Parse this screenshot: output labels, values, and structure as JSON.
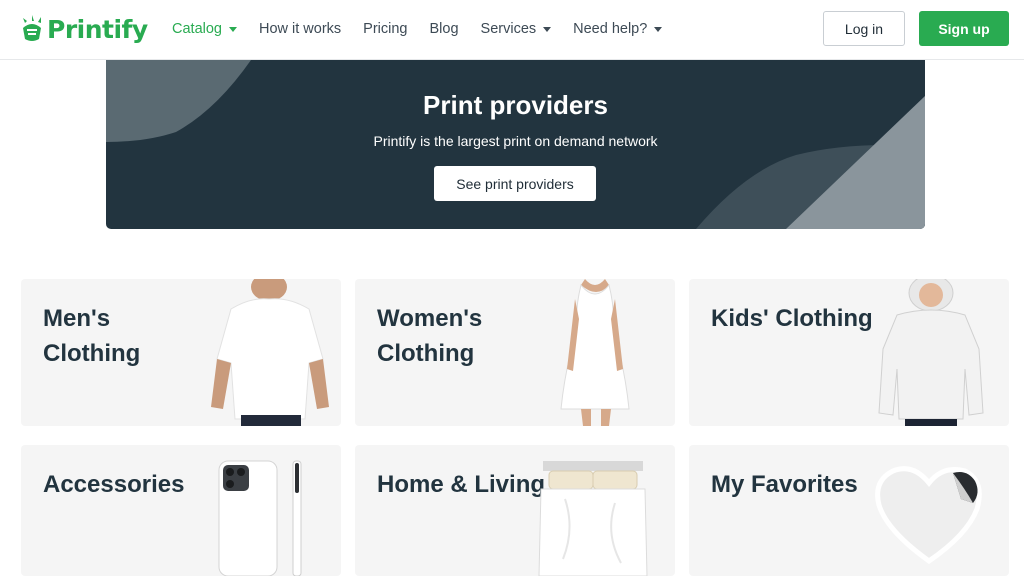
{
  "header": {
    "logo_text": "Printify",
    "nav": [
      {
        "label": "Catalog",
        "has_dropdown": true,
        "active": true
      },
      {
        "label": "How it works",
        "has_dropdown": false
      },
      {
        "label": "Pricing",
        "has_dropdown": false
      },
      {
        "label": "Blog",
        "has_dropdown": false
      },
      {
        "label": "Services",
        "has_dropdown": true
      },
      {
        "label": "Need help?",
        "has_dropdown": true
      }
    ],
    "login_label": "Log in",
    "signup_label": "Sign up"
  },
  "banner": {
    "title": "Print providers",
    "subtitle": "Printify is the largest print on demand network",
    "button_label": "See print providers"
  },
  "categories": [
    {
      "title": "Men's Clothing",
      "image": "white-tshirt-image"
    },
    {
      "title": "Women's Clothing",
      "image": "white-dress-image"
    },
    {
      "title": "Kids' Clothing",
      "image": "white-hoodie-image"
    },
    {
      "title": "Accessories",
      "image": "phone-case-image"
    },
    {
      "title": "Home & Living",
      "image": "bedding-image"
    },
    {
      "title": "My Favorites",
      "image": "heart-sticker-image"
    }
  ],
  "colors": {
    "brand_green": "#29ab51",
    "banner_bg": "#22343f",
    "card_bg": "#f5f5f5",
    "heading": "#22343f"
  }
}
